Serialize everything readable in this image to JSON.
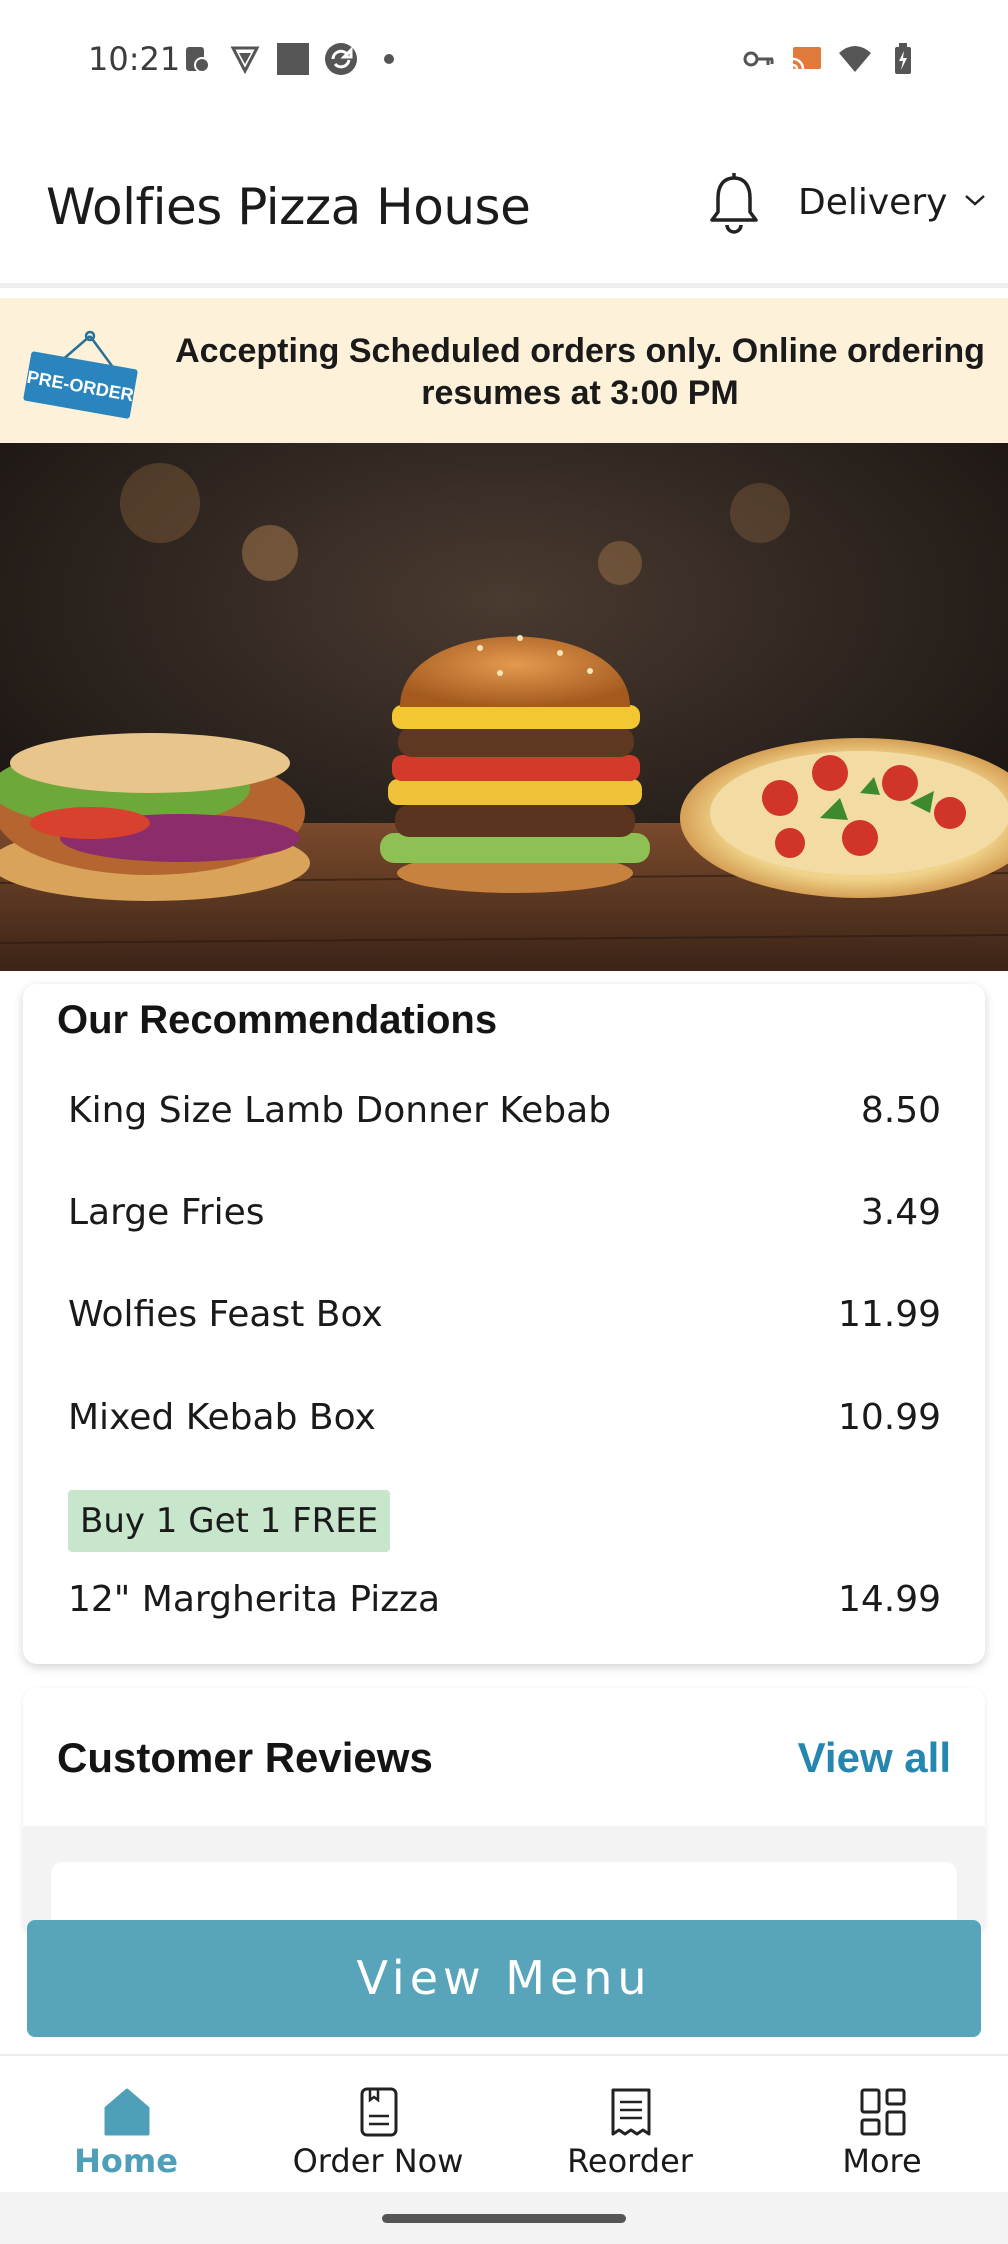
{
  "status_bar": {
    "time": "10:21"
  },
  "header": {
    "title": "Wolfies Pizza House",
    "order_mode": "Delivery",
    "icons": [
      "bell-icon",
      "chevron-down-icon"
    ]
  },
  "banner": {
    "tag_text": "PRE-ORDER",
    "message": "Accepting Scheduled orders only. Online ordering resumes at 3:00 PM"
  },
  "recommendations": {
    "title": "Our Recommendations",
    "items": [
      {
        "name": "King Size Lamb Donner Kebab",
        "price": "8.50"
      },
      {
        "name": "Large Fries",
        "price": "3.49"
      },
      {
        "name": "Wolfies Feast Box",
        "price": "11.99"
      },
      {
        "name": "Mixed Kebab Box",
        "price": "10.99"
      },
      {
        "name": "12\" Margherita Pizza",
        "price": "14.99",
        "badge": "Buy 1 Get 1 FREE"
      }
    ]
  },
  "reviews": {
    "title": "Customer Reviews",
    "view_all": "View all"
  },
  "cta": {
    "label": "View Menu"
  },
  "bottom_nav": {
    "items": [
      {
        "label": "Home",
        "icon": "home-icon",
        "active": true
      },
      {
        "label": "Order Now",
        "icon": "order-icon",
        "active": false
      },
      {
        "label": "Reorder",
        "icon": "receipt-icon",
        "active": false
      },
      {
        "label": "More",
        "icon": "grid-icon",
        "active": false
      }
    ]
  },
  "colors": {
    "accent": "#58a4ba",
    "link": "#2586b0",
    "banner_bg": "#fdf2d9",
    "badge_bg": "#c8e6cc"
  }
}
